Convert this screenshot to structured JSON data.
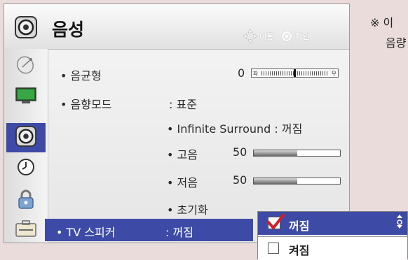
{
  "menu": {
    "title": "음성",
    "nav_hint": {
      "move_label": "이동",
      "ok_label": "확인"
    }
  },
  "sidebar": {
    "items": [
      {
        "name": "satellite-dish-icon"
      },
      {
        "name": "tv-screen-icon"
      },
      {
        "name": "speaker-icon",
        "active": true
      },
      {
        "name": "clock-icon"
      },
      {
        "name": "lock-icon"
      },
      {
        "name": "toolbox-icon"
      }
    ]
  },
  "settings": {
    "balance": {
      "label": "• 음균형",
      "value": "0",
      "left_mark": "좌",
      "right_mark": "우",
      "position": 0.5
    },
    "sound_mode": {
      "label": "• 음향모드",
      "value": ": 표준"
    },
    "infinite_surround": {
      "label": "• Infinite Surround : 꺼짐"
    },
    "treble": {
      "label": "• 고음",
      "value": "50",
      "level_percent": 50
    },
    "bass": {
      "label": "• 저음",
      "value": "50",
      "level_percent": 50
    },
    "reset": {
      "label": "• 초기화"
    },
    "tv_speaker": {
      "label": "• TV 스피커",
      "value": ": 꺼짐"
    }
  },
  "popup": {
    "options": [
      {
        "label": "꺼짐",
        "checked": true
      },
      {
        "label": "켜짐",
        "checked": false
      }
    ]
  },
  "note": {
    "line1": "※ 이",
    "line2": "음량"
  },
  "colors": {
    "accent": "#3d4aa6",
    "check": "#d0202a",
    "background": "#e9dcdb"
  }
}
